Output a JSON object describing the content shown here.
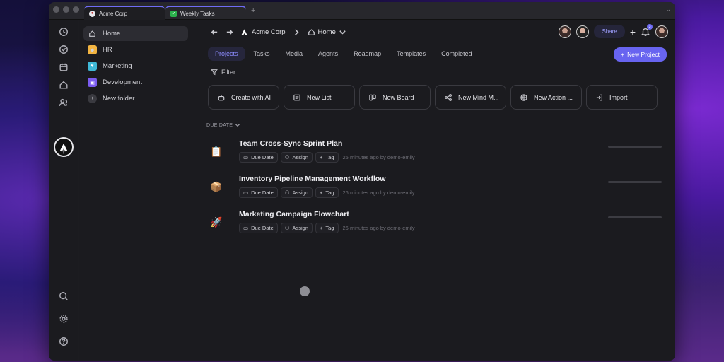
{
  "titlebar": {
    "tabs": [
      {
        "label": "Acme Corp"
      },
      {
        "label": "Weekly Tasks"
      }
    ],
    "new_tab": "+",
    "collapse": "⌄"
  },
  "rail": {
    "icons": [
      "clock-icon",
      "check-circle-icon",
      "calendar-icon",
      "home-icon",
      "users-icon"
    ],
    "add": "+"
  },
  "sidebar": {
    "items": [
      {
        "label": "Home"
      },
      {
        "label": "HR"
      },
      {
        "label": "Marketing"
      },
      {
        "label": "Development"
      },
      {
        "label": "New folder"
      }
    ]
  },
  "nav": {
    "workspace": "Acme Corp",
    "page": "Home"
  },
  "header": {
    "share": "Share",
    "notif_count": "3",
    "new_project": "New Project"
  },
  "view_tabs": [
    "Projects",
    "Tasks",
    "Media",
    "Agents",
    "Roadmap",
    "Templates",
    "Completed"
  ],
  "filter": "Filter",
  "create_cards": [
    "Create with AI",
    "New List",
    "New Board",
    "New Mind M...",
    "New Action ...",
    "Import"
  ],
  "group": "DUE DATE",
  "rows": [
    {
      "emoji": "📋",
      "title": "Team Cross-Sync Sprint Plan",
      "meta": "25 minutes ago by demo-emily"
    },
    {
      "emoji": "📦",
      "title": "Inventory Pipeline Management Workflow",
      "meta": "26 minutes ago by demo-emily"
    },
    {
      "emoji": "🚀",
      "title": "Marketing Campaign Flowchart",
      "meta": "26 minutes ago by demo-emily"
    }
  ],
  "chips": {
    "due": "Due Date",
    "assign": "Assign",
    "tag": "Tag"
  },
  "colors": {
    "accent": "#6864f0",
    "hr": "#f2b441",
    "marketing": "#3fb8d6",
    "development": "#7b5cf0"
  }
}
